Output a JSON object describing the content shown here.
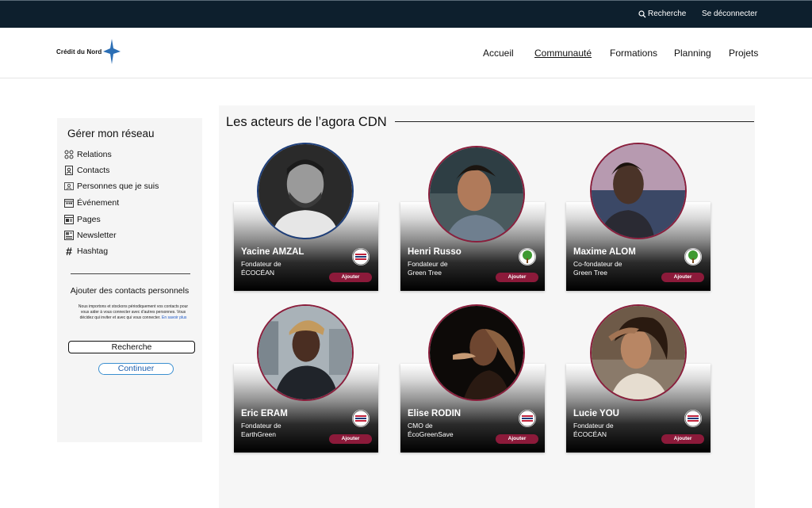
{
  "topbar": {
    "search_label": "Recherche",
    "logout_label": "Se déconnecter"
  },
  "header": {
    "logo_text": "Crédit du Nord",
    "nav": [
      {
        "label": "Accueil",
        "active": false
      },
      {
        "label": "Communauté",
        "active": true
      },
      {
        "label": "Formations",
        "active": false
      },
      {
        "label": "Planning",
        "active": false
      },
      {
        "label": "Projets",
        "active": false
      }
    ]
  },
  "sidebar": {
    "title": "Gérer mon réseau",
    "items": [
      {
        "label": "Relations",
        "icon": "relations-icon"
      },
      {
        "label": "Contacts",
        "icon": "contacts-icon"
      },
      {
        "label": "Personnes que je suis",
        "icon": "following-icon"
      },
      {
        "label": "Événement",
        "icon": "event-icon"
      },
      {
        "label": "Pages",
        "icon": "pages-icon"
      },
      {
        "label": "Newsletter",
        "icon": "newsletter-icon"
      },
      {
        "label": "Hashtag",
        "icon": "hashtag-icon"
      }
    ],
    "import_title": "Ajouter des contacts personnels",
    "import_desc": "Nous importons et stockons périodiquement vos contacts pour vous aider à vous connecter avec d’autres personnes. Vous décidez qui inviter et avec qui vous connecter.",
    "learn_more": "En savoir plus",
    "search_button": "Recherche",
    "continue_button": "Continuer"
  },
  "main": {
    "title": "Les acteurs de l’agora CDN",
    "members": [
      {
        "name": "Yacine AMZAL",
        "role_line1": "Fondateur de",
        "role_line2": "ÉCOCÉAN",
        "badge": "ecocean-logo-icon",
        "action": "Ajouter"
      },
      {
        "name": "Henri Russo",
        "role_line1": "Fondateur de",
        "role_line2": "Green Tree",
        "badge": "green-tree-logo-icon",
        "action": "Ajouter"
      },
      {
        "name": "Maxime ALOM",
        "role_line1": "Co-fondateur de",
        "role_line2": "Green Tree",
        "badge": "green-tree-logo-icon",
        "action": "Ajouter"
      },
      {
        "name": "Eric ERAM",
        "role_line1": "Fondateur de",
        "role_line2": "EarthGreen",
        "badge": "ecocean-logo-icon",
        "action": "Ajouter"
      },
      {
        "name": "Elise RODIN",
        "role_line1": "CMO de",
        "role_line2": "ÉcoGreenSave",
        "badge": "ecocean-logo-icon",
        "action": "Ajouter"
      },
      {
        "name": "Lucie YOU",
        "role_line1": "Fondateur de",
        "role_line2": "ÉCOCÉAN",
        "badge": "ecocean-logo-icon",
        "action": "Ajouter"
      }
    ]
  },
  "colors": {
    "topbar": "#0d1f2d",
    "accent": "#8c1a3a",
    "link": "#1a56c7"
  }
}
